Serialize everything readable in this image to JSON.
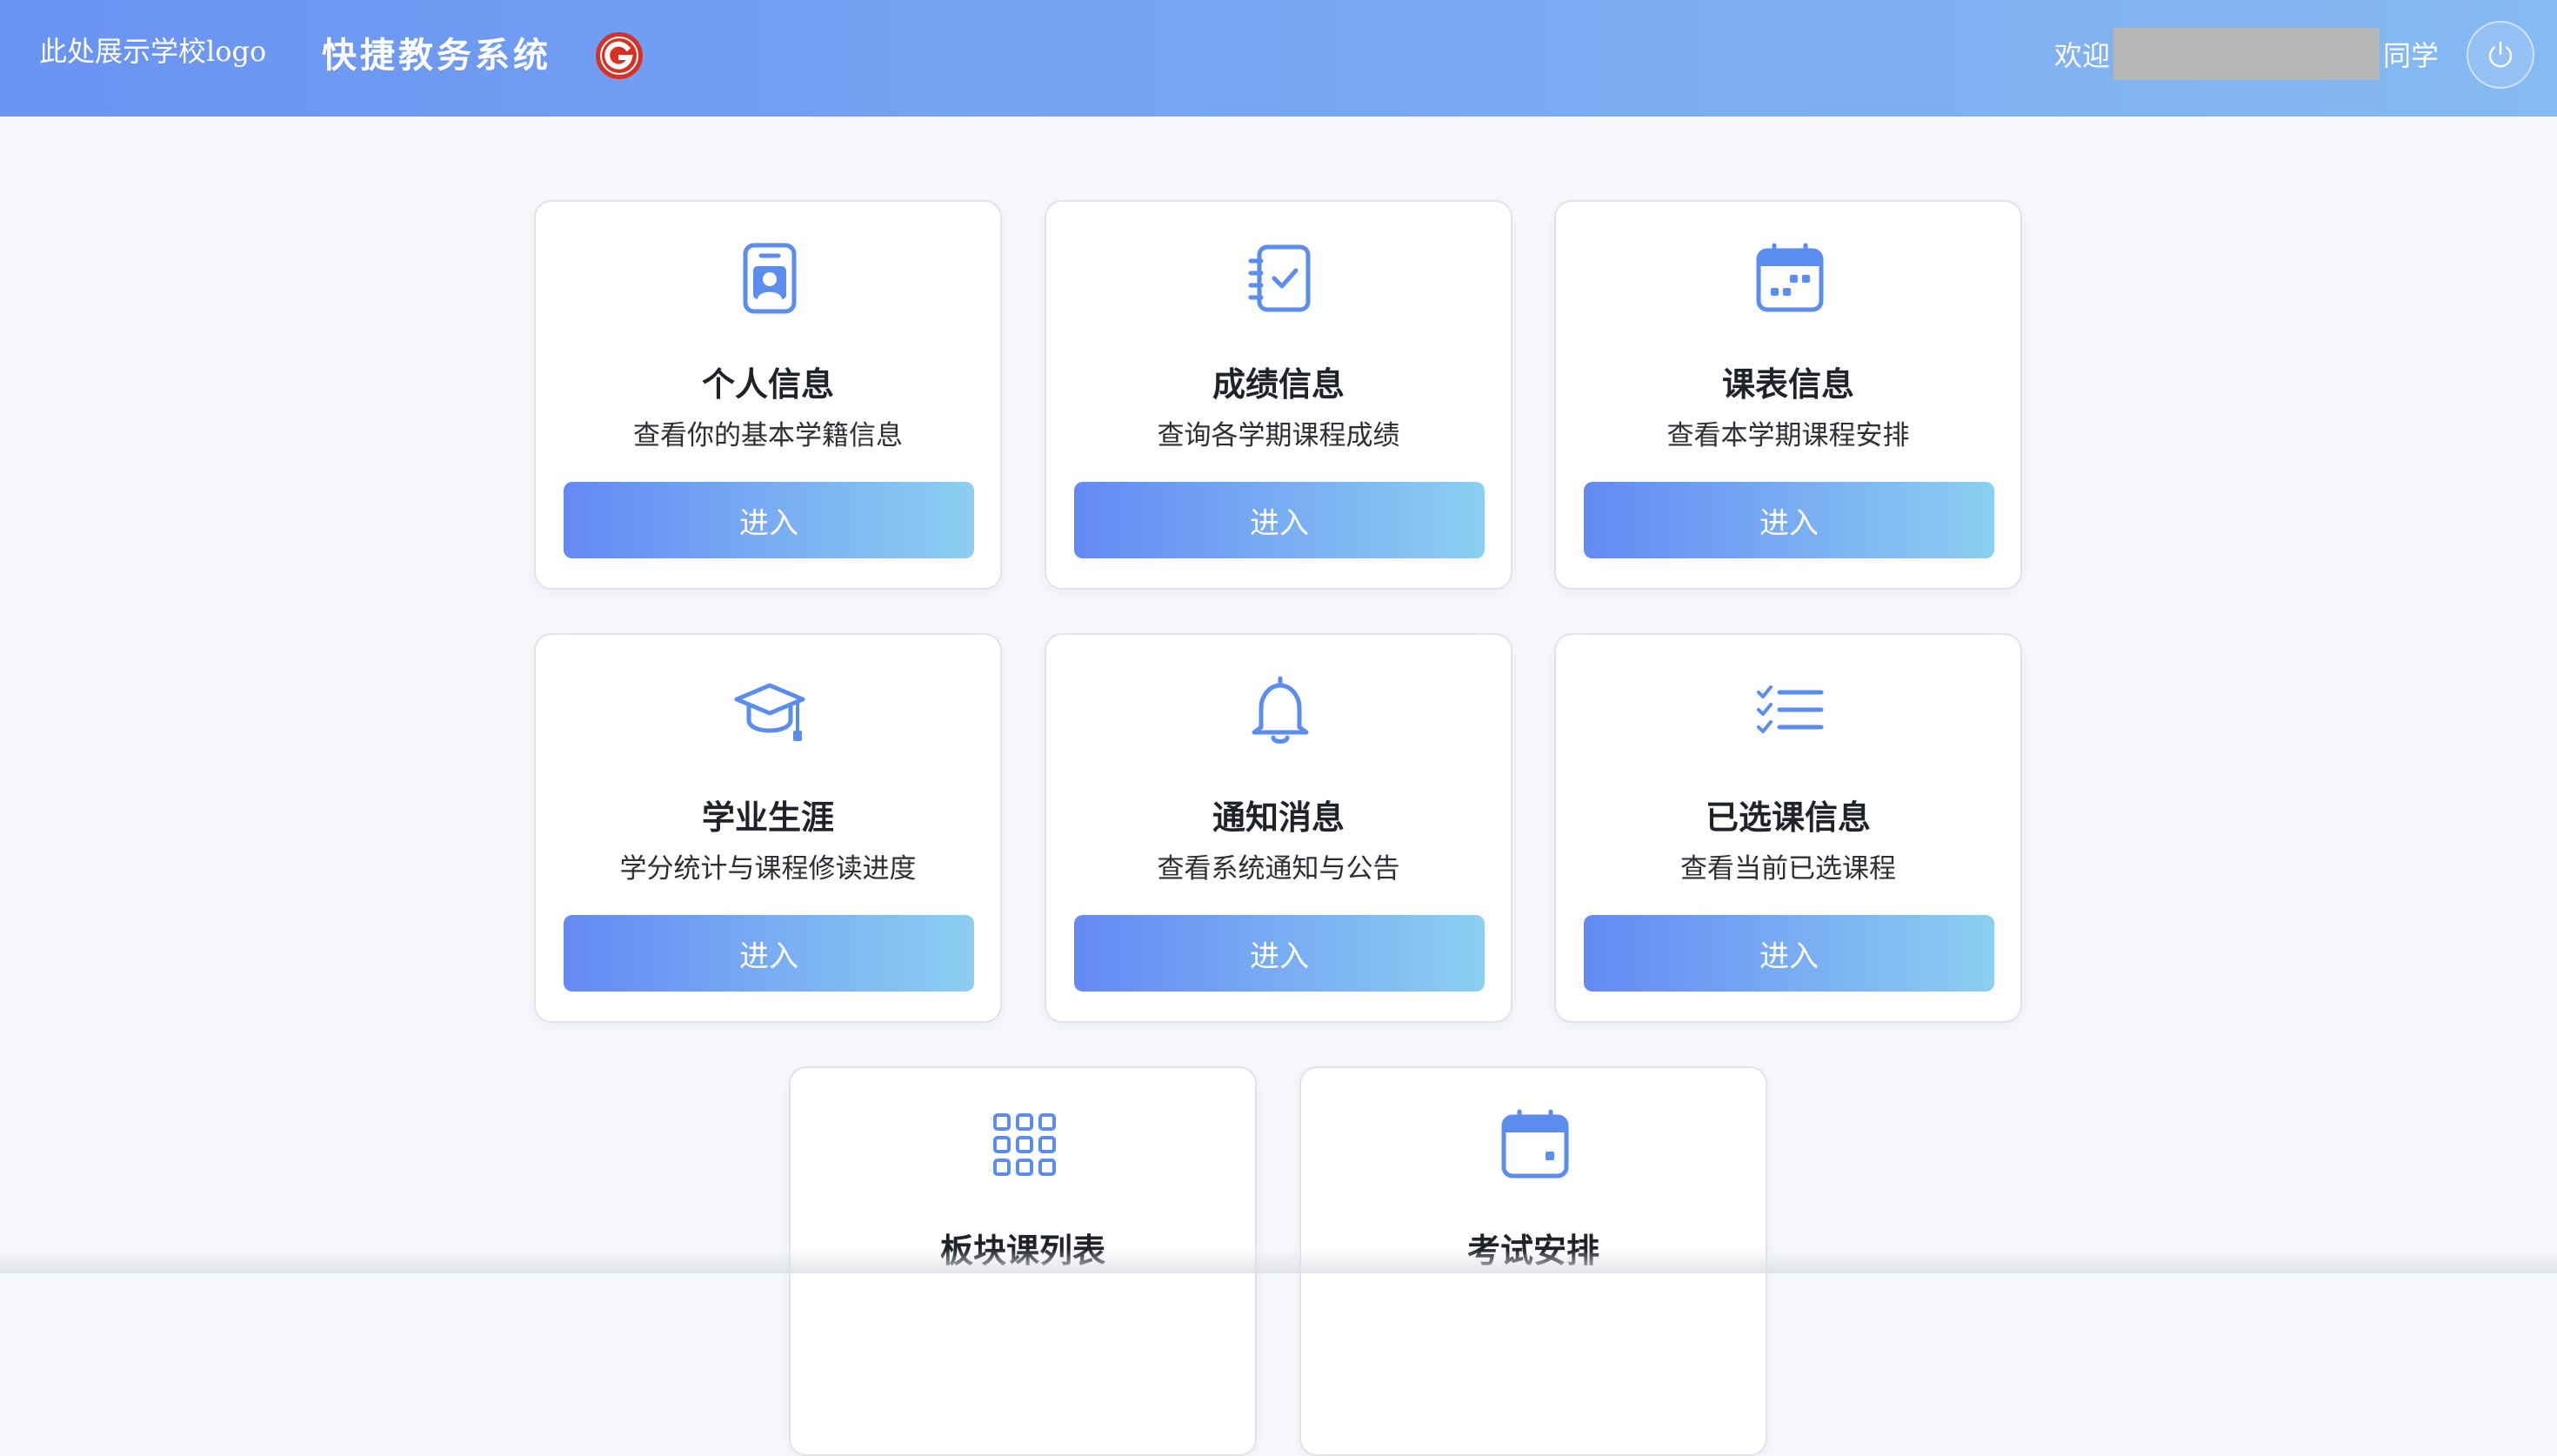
{
  "header": {
    "logo_text": "此处展示学校logo",
    "app_title": "快捷教务系统",
    "welcome_prefix": "欢迎",
    "welcome_suffix": "同学",
    "brand_color": "#d93025"
  },
  "cards": [
    {
      "title": "个人信息",
      "description": "查看你的基本学籍信息",
      "button": "进入",
      "icon": "id-badge-icon"
    },
    {
      "title": "成绩信息",
      "description": "查询各学期课程成绩",
      "button": "进入",
      "icon": "notebook-check-icon"
    },
    {
      "title": "课表信息",
      "description": "查看本学期课程安排",
      "button": "进入",
      "icon": "calendar-schedule-icon"
    },
    {
      "title": "学业生涯",
      "description": "学分统计与课程修读进度",
      "button": "进入",
      "icon": "graduation-cap-icon"
    },
    {
      "title": "通知消息",
      "description": "查看系统通知与公告",
      "button": "进入",
      "icon": "bell-icon"
    },
    {
      "title": "已选课信息",
      "description": "查看当前已选课程",
      "button": "进入",
      "icon": "checklist-icon"
    },
    {
      "title": "板块课列表",
      "description": "",
      "button": "",
      "icon": "grid-icon"
    },
    {
      "title": "考试安排",
      "description": "",
      "button": "",
      "icon": "calendar-icon"
    }
  ],
  "colors": {
    "accent": "#5b8def",
    "button_gradient_start": "#6489f4",
    "button_gradient_end": "#8ccff2"
  }
}
